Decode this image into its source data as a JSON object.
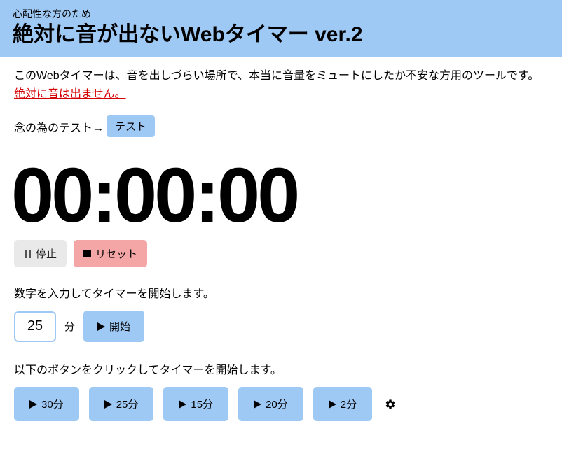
{
  "header": {
    "tagline": "心配性な方のため",
    "title": "絶対に音が出ないWebタイマー ver.2"
  },
  "intro": {
    "line1": "このWebタイマーは、音を出しづらい場所で、本当に音量をミュートにしたか不安な方用のツールです。",
    "assurance": "絶対に音は出ません。"
  },
  "test": {
    "label": "念の為のテスト→",
    "button": "テスト"
  },
  "timer": {
    "display": "00:00:00"
  },
  "controls": {
    "pause": "停止",
    "reset": "リセット"
  },
  "input_section": {
    "label": "数字を入力してタイマーを開始します。",
    "value": "25",
    "unit": "分",
    "start": "開始"
  },
  "preset_section": {
    "label": "以下のボタンをクリックしてタイマーを開始します。",
    "buttons": [
      "30分",
      "25分",
      "15分",
      "20分",
      "2分"
    ]
  },
  "icons": {
    "gear": "settings"
  }
}
